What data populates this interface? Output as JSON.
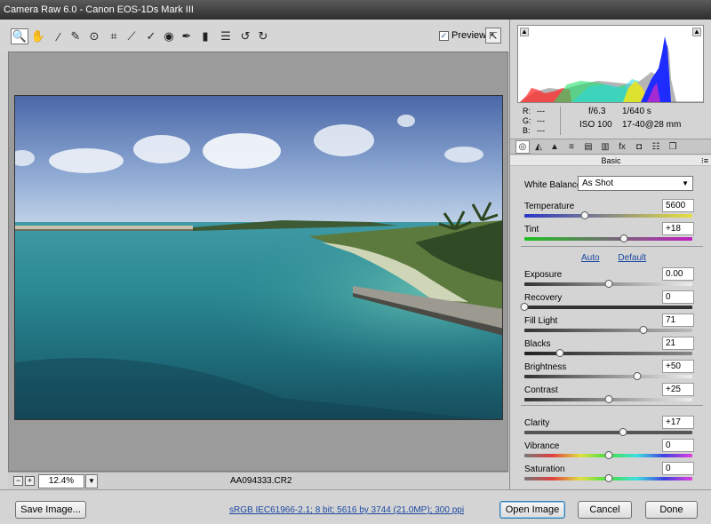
{
  "window": {
    "title": "Camera Raw 6.0  -  Canon EOS-1Ds Mark III"
  },
  "toolbar": {
    "tools": [
      {
        "name": "zoom-tool",
        "glyph": "🔍"
      },
      {
        "name": "hand-tool",
        "glyph": "✋"
      },
      {
        "name": "white-balance-tool",
        "glyph": "⁄"
      },
      {
        "name": "color-sampler-tool",
        "glyph": "✎"
      },
      {
        "name": "target-adjustment-tool",
        "glyph": "⊙"
      },
      {
        "name": "crop-tool",
        "glyph": "⌗"
      },
      {
        "name": "straighten-tool",
        "glyph": "⟋"
      },
      {
        "name": "spot-removal-tool",
        "glyph": "✓"
      },
      {
        "name": "red-eye-tool",
        "glyph": "◉"
      },
      {
        "name": "adjustment-brush-tool",
        "glyph": "✒"
      },
      {
        "name": "graduated-filter-tool",
        "glyph": "▮"
      },
      {
        "name": "preferences-tool",
        "glyph": "☰"
      },
      {
        "name": "rotate-ccw-tool",
        "glyph": "↺"
      },
      {
        "name": "rotate-cw-tool",
        "glyph": "↻"
      }
    ],
    "preview_label": "Preview",
    "preview_checked": "✓",
    "fullscreen_glyph": "⇱"
  },
  "canvas": {
    "zoom_value": "12.4%",
    "zoom_out": "−",
    "zoom_in": "+",
    "dropdown_caret": "▼",
    "filename": "AA094333.CR2"
  },
  "histogram": {
    "corner_left": "▲",
    "corner_right": "▲"
  },
  "readout": {
    "r_label": "R:",
    "g_label": "G:",
    "b_label": "B:",
    "r_val": "---",
    "g_val": "---",
    "b_val": "---",
    "aperture": "f/6.3",
    "shutter": "1/640 s",
    "iso": "ISO 100",
    "lens": "17-40@28 mm"
  },
  "panel": {
    "tabs": [
      "◎",
      "◭",
      "▲",
      "≡",
      "▤",
      "▥",
      "fx",
      "◘",
      "☷",
      "❐"
    ],
    "section_title": "Basic",
    "section_menu": "⁝≡",
    "white_balance_label": "White Balance:",
    "white_balance_value": "As Shot",
    "auto_link": "Auto",
    "default_link": "Default",
    "sliders": {
      "temperature": {
        "label": "Temperature",
        "value": "5600",
        "pos": 0.36
      },
      "tint": {
        "label": "Tint",
        "value": "+18",
        "pos": 0.59
      },
      "exposure": {
        "label": "Exposure",
        "value": "0.00",
        "pos": 0.5
      },
      "recovery": {
        "label": "Recovery",
        "value": "0",
        "pos": 0.0
      },
      "fill_light": {
        "label": "Fill Light",
        "value": "71",
        "pos": 0.71
      },
      "blacks": {
        "label": "Blacks",
        "value": "21",
        "pos": 0.21
      },
      "brightness": {
        "label": "Brightness",
        "value": "+50",
        "pos": 0.67
      },
      "contrast": {
        "label": "Contrast",
        "value": "+25",
        "pos": 0.5
      },
      "clarity": {
        "label": "Clarity",
        "value": "+17",
        "pos": 0.585
      },
      "vibrance": {
        "label": "Vibrance",
        "value": "0",
        "pos": 0.5
      },
      "saturation": {
        "label": "Saturation",
        "value": "0",
        "pos": 0.5
      }
    }
  },
  "footer": {
    "save_image": "Save Image...",
    "workflow_info": "sRGB IEC61966-2.1; 8 bit; 5616 by 3744 (21.0MP); 300 ppi",
    "open_image": "Open Image",
    "cancel": "Cancel",
    "done": "Done"
  }
}
